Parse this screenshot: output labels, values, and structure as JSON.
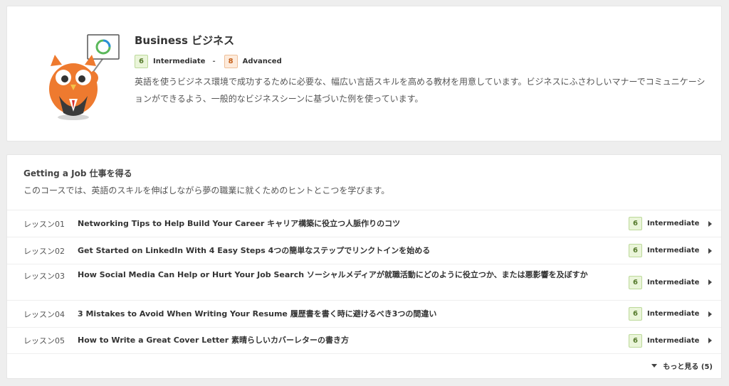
{
  "course": {
    "title": "Business ビジネス",
    "level_from": {
      "number": "6",
      "label": "Intermediate",
      "color": "#557a2c"
    },
    "level_sep": "-",
    "level_to": {
      "number": "8",
      "label": "Advanced",
      "color": "#c45f1a"
    },
    "description": "英語を使うビジネス環境で成功するために必要な、幅広い言語スキルを高める教材を用意しています。ビジネスにふさわしいマナーでコミュニケーションができるよう、一般的なビジネスシーンに基づいた例を使っています。"
  },
  "lessons_section": {
    "title": "Getting a Job 仕事を得る",
    "subtitle": "このコースでは、英語のスキルを伸ばしながら夢の職業に就くためのヒントとこつを学びます。",
    "items": [
      {
        "number": "レッスン01",
        "title": "Networking Tips to Help Build Your Career キャリア構築に役立つ人脈作りのコツ",
        "level_number": "6",
        "level_label": "Intermediate"
      },
      {
        "number": "レッスン02",
        "title": "Get Started on LinkedIn With 4 Easy Steps 4つの簡単なステップでリンクトインを始める",
        "level_number": "6",
        "level_label": "Intermediate"
      },
      {
        "number": "レッスン03",
        "title": "How Social Media Can Help or Hurt Your Job Search ソーシャルメディアが就職活動にどのように役立つか、または悪影響を及ぼすか",
        "level_number": "6",
        "level_label": "Intermediate"
      },
      {
        "number": "レッスン04",
        "title": "3 Mistakes to Avoid When Writing Your Resume 履歴書を書く時に避けるべき3つの間違い",
        "level_number": "6",
        "level_label": "Intermediate"
      },
      {
        "number": "レッスン05",
        "title": "How to Write a Great Cover Letter 素晴らしいカバーレターの書き方",
        "level_number": "6",
        "level_label": "Intermediate"
      }
    ],
    "more_label": "もっと見る (5)"
  },
  "icons": {
    "mascot": "owl-mascot-icon",
    "row_arrow": "chevron-right-icon",
    "more_arrow": "caret-down-icon"
  },
  "colors": {
    "background": "#eeeeee",
    "card": "#ffffff",
    "mascot_orange": "#ee7a2f",
    "badge_green_bg": "#eaf5d9",
    "badge_orange_bg": "#fdebdc"
  }
}
